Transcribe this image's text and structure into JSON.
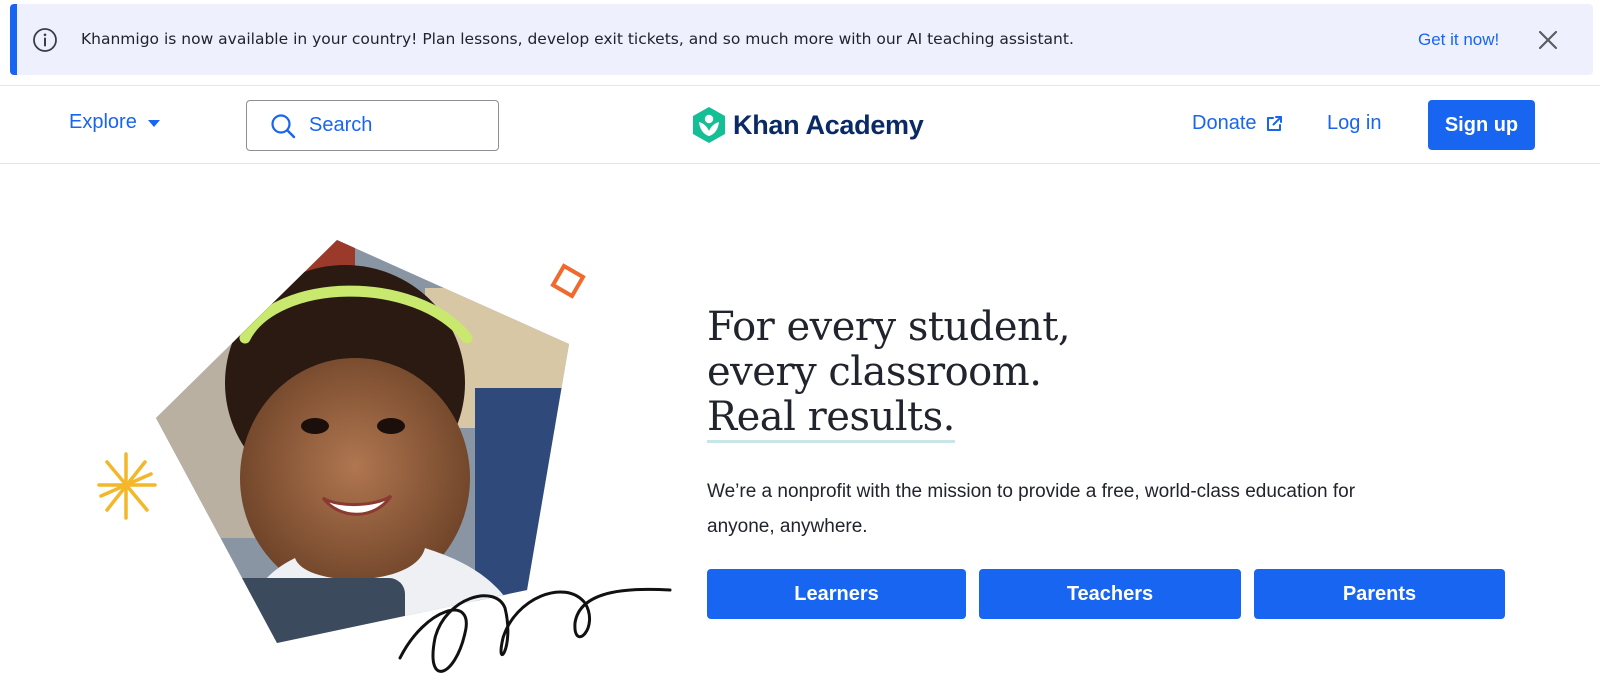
{
  "banner": {
    "message": "Khanmigo is now available in your country! Plan lessons, develop exit tickets, and so much more with our AI teaching assistant.",
    "cta_label": "Get it now!",
    "icon": "info-icon",
    "close_icon": "close-icon"
  },
  "header": {
    "explore_label": "Explore",
    "search_placeholder": "Search",
    "logo_text": "Khan Academy",
    "donate_label": "Donate",
    "login_label": "Log in",
    "signup_label": "Sign up"
  },
  "hero": {
    "title_lines": [
      "For every student,",
      "every classroom.",
      "Real results."
    ],
    "description": "We’re a nonprofit with the mission to provide a free, world-class education for anyone, anywhere.",
    "buttons": [
      "Learners",
      "Teachers",
      "Parents"
    ]
  },
  "colors": {
    "brand_blue": "#1865f2",
    "banner_bg": "#eef1fd",
    "logo_green": "#14bf96",
    "logo_navy": "#0a2a66"
  }
}
